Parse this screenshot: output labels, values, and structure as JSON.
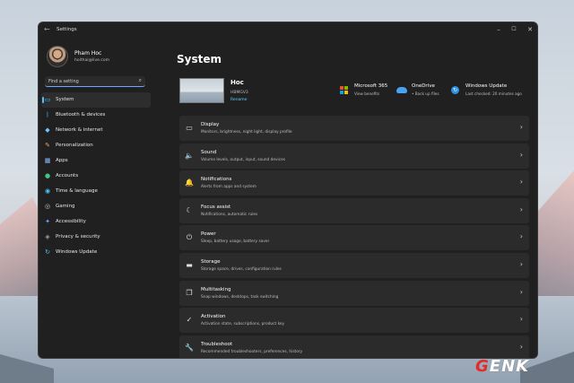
{
  "window": {
    "title": "Settings"
  },
  "profile": {
    "name": "Pham Hoc",
    "email": "hoithai@live.com"
  },
  "search": {
    "placeholder": "Find a setting"
  },
  "nav": [
    {
      "label": "System",
      "icon": "monitor-icon",
      "color": "#4cc2ff",
      "active": true
    },
    {
      "label": "Bluetooth & devices",
      "icon": "bluetooth-icon",
      "color": "#3aa0ff"
    },
    {
      "label": "Network & internet",
      "icon": "wifi-icon",
      "color": "#6cc7ff"
    },
    {
      "label": "Personalization",
      "icon": "brush-icon",
      "color": "#f0a060"
    },
    {
      "label": "Apps",
      "icon": "apps-icon",
      "color": "#8fb8ff"
    },
    {
      "label": "Accounts",
      "icon": "person-icon",
      "color": "#40c880"
    },
    {
      "label": "Time & language",
      "icon": "globe-clock-icon",
      "color": "#4cc2ff"
    },
    {
      "label": "Gaming",
      "icon": "gamepad-icon",
      "color": "#c0c0c0"
    },
    {
      "label": "Accessibility",
      "icon": "accessibility-icon",
      "color": "#5aa8ff"
    },
    {
      "label": "Privacy & security",
      "icon": "shield-icon",
      "color": "#a0a0a0"
    },
    {
      "label": "Windows Update",
      "icon": "update-icon",
      "color": "#4cc2ff"
    }
  ],
  "main": {
    "title": "System",
    "device": {
      "name": "Hoc",
      "model": "HBMGV3",
      "rename": "Rename"
    },
    "quick": [
      {
        "title": "Microsoft 365",
        "subtitle": "View benefits",
        "icon": "microsoft-icon"
      },
      {
        "title": "OneDrive",
        "subtitle": "• Back up files",
        "icon": "onedrive-icon"
      },
      {
        "title": "Windows Update",
        "subtitle": "Last checked: 20 minutes ago",
        "icon": "update-icon"
      }
    ],
    "cards": [
      {
        "title": "Display",
        "subtitle": "Monitors, brightness, night light, display profile",
        "icon": "display-icon",
        "glyph": "▭"
      },
      {
        "title": "Sound",
        "subtitle": "Volume levels, output, input, sound devices",
        "icon": "speaker-icon",
        "glyph": "🔈"
      },
      {
        "title": "Notifications",
        "subtitle": "Alerts from apps and system",
        "icon": "bell-icon",
        "glyph": "🔔"
      },
      {
        "title": "Focus assist",
        "subtitle": "Notifications, automatic rules",
        "icon": "moon-icon",
        "glyph": "☾"
      },
      {
        "title": "Power",
        "subtitle": "Sleep, battery usage, battery saver",
        "icon": "power-icon",
        "glyph": "⏻"
      },
      {
        "title": "Storage",
        "subtitle": "Storage space, drives, configuration rules",
        "icon": "storage-icon",
        "glyph": "▬"
      },
      {
        "title": "Multitasking",
        "subtitle": "Snap windows, desktops, task switching",
        "icon": "multitasking-icon",
        "glyph": "❐"
      },
      {
        "title": "Activation",
        "subtitle": "Activation state, subscriptions, product key",
        "icon": "check-circle-icon",
        "glyph": "✓"
      },
      {
        "title": "Troubleshoot",
        "subtitle": "Recommended troubleshooters, preferences, history",
        "icon": "wrench-icon",
        "glyph": "🔧"
      }
    ]
  },
  "watermark": {
    "g": "G",
    "rest": "ENK"
  }
}
